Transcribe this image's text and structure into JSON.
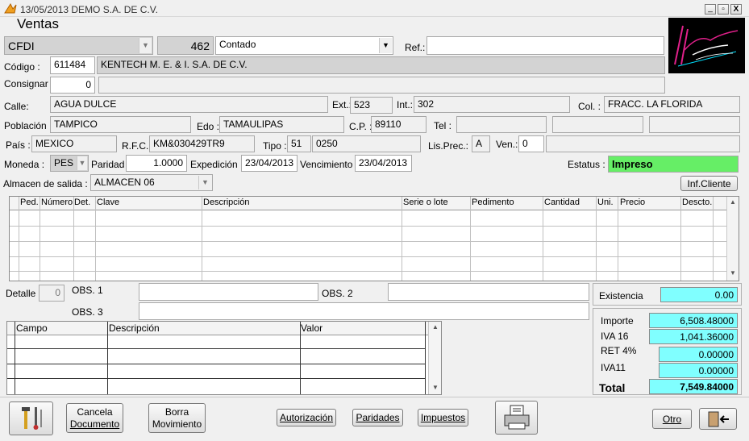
{
  "titlebar": {
    "title": "13/05/2013  DEMO  S.A. DE C.V."
  },
  "window": {
    "heading": "Ventas",
    "win_min": "_",
    "win_restore": "▫",
    "win_close": "X"
  },
  "doc": {
    "type": "CFDI",
    "number": "462",
    "payment": "Contado",
    "ref_label": "Ref.:",
    "ref_value": ""
  },
  "client": {
    "codigo_label": "Código :",
    "codigo": "611484",
    "name": "KENTECH M. E. & I. S.A. DE C.V.",
    "consignar_label": "Consignar",
    "consignar": "0",
    "calle_label": "Calle:",
    "calle": "AGUA DULCE",
    "ext_label": "Ext.:",
    "ext": "523",
    "int_label": "Int.:",
    "int": "302",
    "col_label": "Col. :",
    "col": "FRACC. LA FLORIDA",
    "poblacion_label": "Población",
    "poblacion": "TAMPICO",
    "edo_label": "Edo :",
    "edo": "TAMAULIPAS",
    "cp_label": "C.P. :",
    "cp": "89110",
    "tel_label": "Tel :",
    "pais_label": "País :",
    "pais": "MEXICO",
    "rfc_label": "R.F.C.:",
    "rfc": "KM&030429TR9",
    "tipo_label": "Tipo :",
    "tipo_a": "51",
    "tipo_b": "0250",
    "lisprec_label": "Lis.Prec.:",
    "lisprec": "A",
    "ven_label": "Ven.:",
    "ven": "0"
  },
  "moneda": {
    "moneda_label": "Moneda :",
    "moneda": "PES",
    "paridad_label": "Paridad",
    "paridad": "1.0000",
    "expedicion_label": "Expedición",
    "expedicion": "23/04/2013",
    "vencimiento_label": "Vencimiento",
    "vencimiento": "23/04/2013",
    "estatus_label": "Estatus :",
    "estatus": "Impreso",
    "almacen_label": "Almacen de salida :",
    "almacen": "ALMACEN 06",
    "infcliente": "Inf.Cliente"
  },
  "items_grid": {
    "columns": [
      "Ped.",
      "Número",
      "Det.",
      "Clave",
      "Descripción",
      "Serie o lote",
      "Pedimento",
      "Cantidad",
      "Uni.",
      "Precio",
      "Descto."
    ]
  },
  "detail": {
    "detalle_label": "Detalle",
    "detalle": "0",
    "obs1_label": "OBS. 1",
    "obs2_label": "OBS. 2",
    "obs3_label": "OBS. 3"
  },
  "fields_grid": {
    "columns": [
      "Campo",
      "Descripción",
      "Valor"
    ]
  },
  "totals": {
    "existencia_label": "Existencia",
    "existencia": "0.00",
    "importe_label": "Importe",
    "importe": "6,508.48000",
    "iva16_label": "IVA 16",
    "iva16": "1,041.36000",
    "ret4_label": "RET 4%",
    "ret4": "0.00000",
    "iva11_label": "IVA11",
    "iva11": "0.00000",
    "total_label": "Total",
    "total": "7,549.84000"
  },
  "toolbar": {
    "cancela_1": "Cancela",
    "cancela_2": "Documento",
    "borra_1": "Borra",
    "borra_2": "Movimiento",
    "autorizacion": "Autorización",
    "paridades": "Paridades",
    "impuestos": "Impuestos",
    "otro": "Otro"
  },
  "colors": {
    "estatus_bg": "#66ee66",
    "totals_bg": "#80ffff",
    "grid_bg": "#ffffff"
  }
}
